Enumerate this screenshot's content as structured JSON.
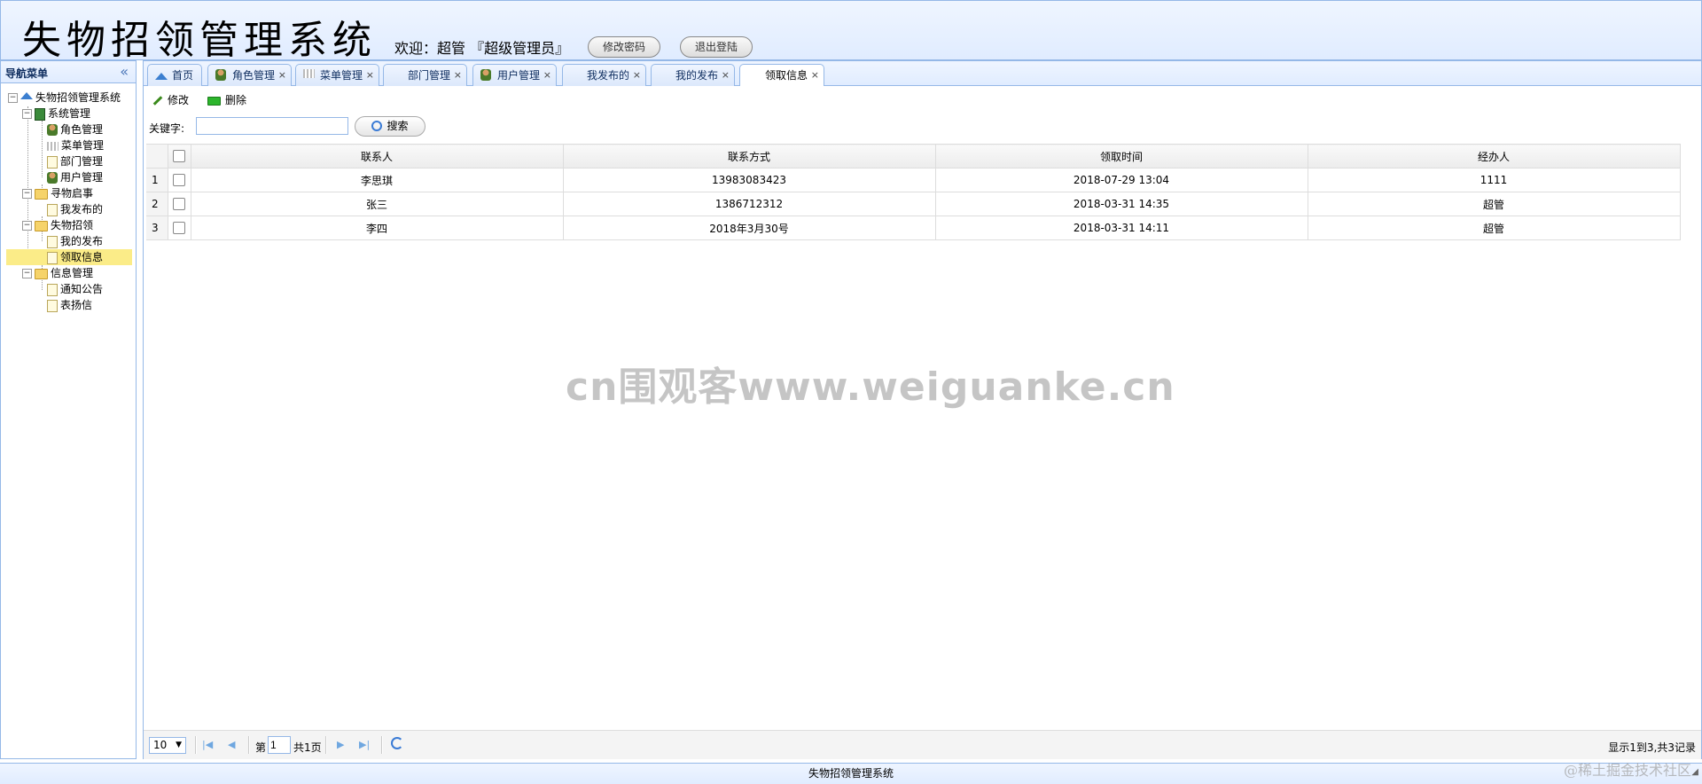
{
  "header": {
    "app_title": "失物招领管理系统",
    "welcome": "欢迎：超管 『超级管理员』",
    "change_password": "修改密码",
    "logout": "退出登陆"
  },
  "west": {
    "title": "导航菜单",
    "tree": [
      {
        "label": "失物招领管理系统",
        "icon": "home-icon"
      },
      {
        "label": "系统管理",
        "icon": "book-icon"
      },
      {
        "label": "角色管理",
        "icon": "user-icon"
      },
      {
        "label": "菜单管理",
        "icon": "menu-icon"
      },
      {
        "label": "部门管理",
        "icon": "file-icon"
      },
      {
        "label": "用户管理",
        "icon": "user-icon"
      },
      {
        "label": "寻物启事",
        "icon": "folder-icon"
      },
      {
        "label": "我发布的",
        "icon": "file-icon"
      },
      {
        "label": "失物招领",
        "icon": "folder-icon"
      },
      {
        "label": "我的发布",
        "icon": "file-icon"
      },
      {
        "label": "领取信息",
        "icon": "file-icon",
        "selected": true
      },
      {
        "label": "信息管理",
        "icon": "folder-icon"
      },
      {
        "label": "通知公告",
        "icon": "file-icon"
      },
      {
        "label": "表扬信",
        "icon": "file-icon"
      }
    ]
  },
  "tabs": [
    {
      "label": "首页",
      "icon": "home-icon",
      "closable": false
    },
    {
      "label": "角色管理",
      "icon": "user-icon",
      "closable": true
    },
    {
      "label": "菜单管理",
      "icon": "menu-icon",
      "closable": true
    },
    {
      "label": "部门管理",
      "icon": "",
      "closable": true
    },
    {
      "label": "用户管理",
      "icon": "user-icon",
      "closable": true
    },
    {
      "label": "我发布的",
      "icon": "",
      "closable": true
    },
    {
      "label": "我的发布",
      "icon": "",
      "closable": true
    },
    {
      "label": "领取信息",
      "icon": "",
      "closable": true,
      "active": true
    }
  ],
  "toolbar": {
    "edit": "修改",
    "delete": "删除",
    "keyword_label": "关键字:",
    "keyword_value": "",
    "search": "搜索"
  },
  "grid": {
    "columns": [
      "联系人",
      "联系方式",
      "领取时间",
      "经办人"
    ],
    "rows": [
      {
        "no": "1",
        "contact": "李思琪",
        "phone": "13983083423",
        "time": "2018-07-29 13:04",
        "handler": "1111"
      },
      {
        "no": "2",
        "contact": "张三",
        "phone": "1386712312",
        "time": "2018-03-31 14:35",
        "handler": "超管"
      },
      {
        "no": "3",
        "contact": "李四",
        "phone": "2018年3月30号",
        "time": "2018-03-31 14:11",
        "handler": "超管"
      }
    ]
  },
  "pager": {
    "page_size": "10",
    "page_prefix": "第",
    "page_value": "1",
    "total_pages": "共1页",
    "info": "显示1到3,共3记录"
  },
  "footer": {
    "text": "失物招领管理系统"
  },
  "watermark": "cn围观客www.weiguanke.cn",
  "corner_mark": "@稀土掘金技术社区",
  "colors": {
    "border": "#95b8e7",
    "header_bg": "#e0ecff",
    "selected": "#fbec88"
  }
}
